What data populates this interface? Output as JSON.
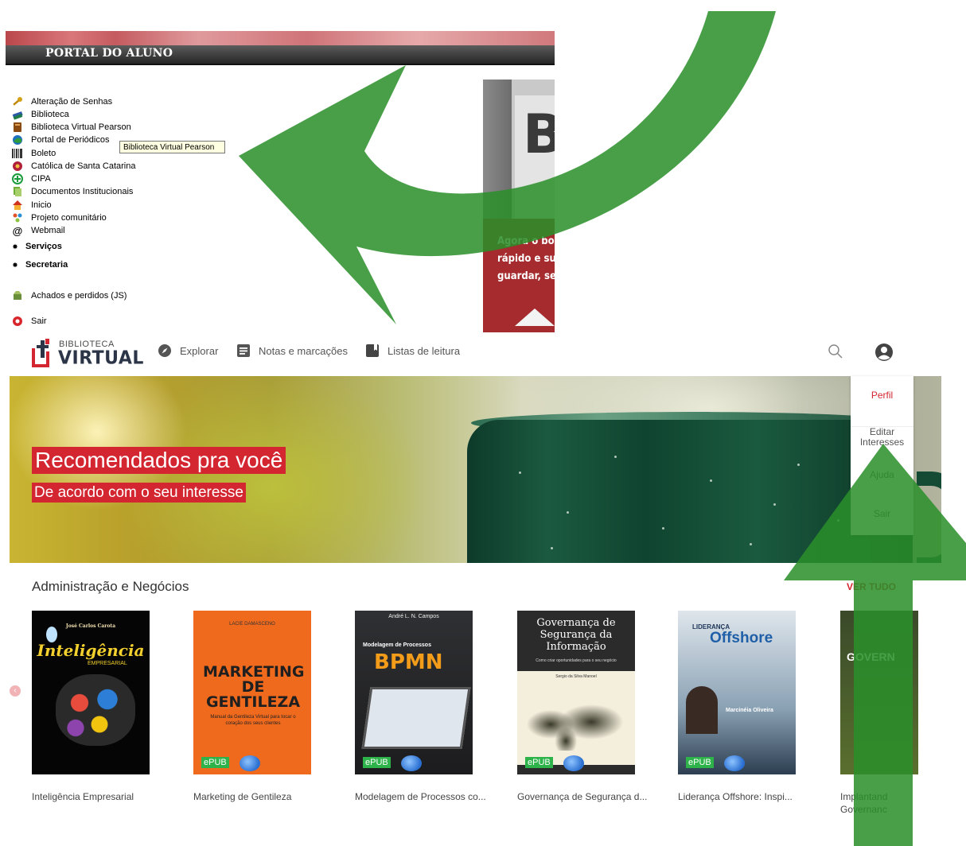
{
  "portal": {
    "title": "PORTAL DO ALUNO",
    "menu": [
      {
        "label": "Alteração de Senhas",
        "icon": "key-icon"
      },
      {
        "label": "Biblioteca",
        "icon": "books-icon"
      },
      {
        "label": "Biblioteca Virtual Pearson",
        "icon": "book-icon"
      },
      {
        "label": "Portal de Periódicos",
        "icon": "globe-icon"
      },
      {
        "label": "Boleto",
        "icon": "barcode-icon"
      },
      {
        "label": "Católica de Santa Catarina",
        "icon": "flower-icon"
      },
      {
        "label": "CIPA",
        "icon": "cross-circle-icon"
      },
      {
        "label": "Documentos Institucionais",
        "icon": "documents-icon"
      },
      {
        "label": "Inicio",
        "icon": "home-icon"
      },
      {
        "label": "Projeto comunitário",
        "icon": "people-icon"
      },
      {
        "label": "Webmail",
        "icon": "at-icon"
      }
    ],
    "sections": [
      "Serviços",
      "Secretaria"
    ],
    "extra": [
      {
        "label": "Achados e perdidos (JS)",
        "icon": "box-icon"
      },
      {
        "label": "Sair",
        "icon": "exit-icon"
      }
    ],
    "tooltip": "Biblioteca Virtual Pearson",
    "promo_text": [
      "Agora o bole",
      "rápido e sust",
      "guardar, sem"
    ],
    "promo_letter": "B"
  },
  "bv": {
    "logo_top": "BIBLIOTECA",
    "logo_bottom": "VIRTUAL",
    "nav": [
      {
        "label": "Explorar",
        "icon": "compass-icon"
      },
      {
        "label": "Notas e marcações",
        "icon": "notes-icon"
      },
      {
        "label": "Listas de leitura",
        "icon": "bookmark-icon"
      }
    ],
    "hero_title": "Recomendados pra você",
    "hero_subtitle": "De acordo com o seu interesse",
    "profile_menu": [
      "Perfil",
      "Editar Interesses",
      "Ajuda",
      "Sair"
    ],
    "shelf_title": "Administração e Negócios",
    "see_all": "VER TUDO",
    "books": [
      {
        "caption": "Inteligência Empresarial",
        "cover_title": "Inteligência",
        "cover_sub": "EMPRESARIAL",
        "author": "José Carlos Carota",
        "epub": ""
      },
      {
        "caption": "Marketing de Gentileza",
        "cover_title": "MARKETING DE GENTILEZA",
        "cover_sub": "Manual da Gentileza Virtual para tocar o coração dos seus clientes",
        "author": "LACIE DAMASCENO",
        "epub": "ePUB"
      },
      {
        "caption": "Modelagem de Processos co...",
        "cover_title": "BPMN",
        "cover_sub": "Modelagem de Processos",
        "author": "André L. N. Campos",
        "epub": "ePUB"
      },
      {
        "caption": "Governança de Segurança d...",
        "cover_title": "Governança de Segurança da Informação",
        "cover_sub": "Como criar oportunidades para o seu negócio",
        "author": "Sergio da Silva Manoel",
        "epub": "ePUB"
      },
      {
        "caption": "Liderança Offshore: Inspi...",
        "cover_title": "Offshore",
        "cover_sub": "LIDERANÇA",
        "author": "Marcinéia Oliveira",
        "epub": "ePUB"
      },
      {
        "caption": "Implantand Governanc",
        "cover_title": "GOVERN",
        "cover_sub": "",
        "author": "",
        "epub": ""
      }
    ]
  },
  "colors": {
    "accent_red": "#d32630",
    "arrow_green": "#2a8f2a",
    "portal_red": "#a52b2e"
  }
}
